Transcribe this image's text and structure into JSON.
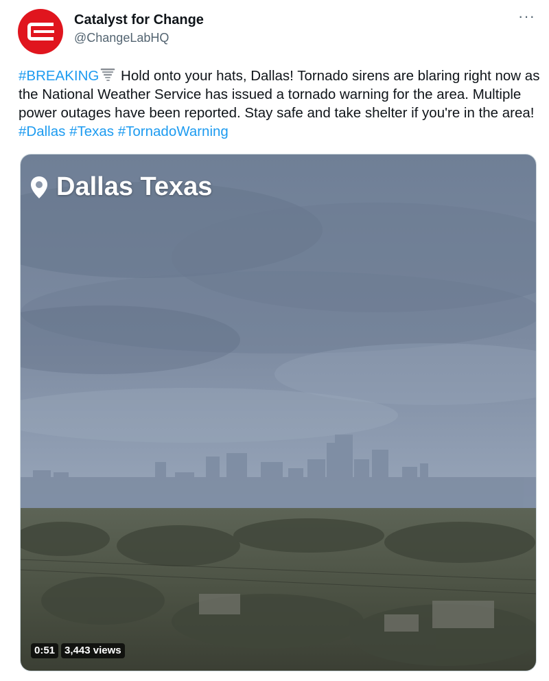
{
  "author": {
    "display_name": "Catalyst for Change",
    "handle": "@ChangeLabHQ",
    "avatar_color": "#e0151e"
  },
  "more_label": "···",
  "tweet": {
    "breaking_tag": "#BREAKING",
    "emoji": "tornado-emoji",
    "body": " Hold onto your hats, Dallas! Tornado sirens are blaring right now as the National Weather Service has issued a tornado warning for the area. Multiple power outages have been reported. Stay safe and take shelter if you're in the area! ",
    "hashtags": [
      "#Dallas",
      "#Texas",
      "#TornadoWarning"
    ],
    "hashtag_color": "#1d9bf0"
  },
  "media": {
    "location_icon": "map-pin-icon",
    "location": "Dallas Texas",
    "duration": "0:51",
    "views": "3,443 views"
  }
}
